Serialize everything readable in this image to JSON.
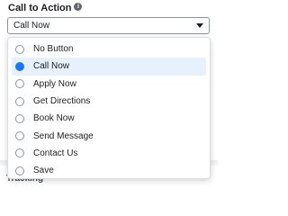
{
  "field": {
    "label": "Call to Action",
    "info_glyph": "i",
    "selected_value": "Call Now",
    "icons": {
      "info": "info-icon",
      "caret": "caret-down-icon"
    }
  },
  "colors": {
    "accent": "#1877f2",
    "selected_row": "#e7f0fd",
    "border": "#8d949e"
  },
  "options": [
    {
      "label": "No Button",
      "selected": false
    },
    {
      "label": "Call Now",
      "selected": true
    },
    {
      "label": "Apply Now",
      "selected": false
    },
    {
      "label": "Get Directions",
      "selected": false
    },
    {
      "label": "Book Now",
      "selected": false
    },
    {
      "label": "Send Message",
      "selected": false
    },
    {
      "label": "Contact Us",
      "selected": false
    },
    {
      "label": "Save",
      "selected": false
    }
  ],
  "background": {
    "section_heading": "Tracking"
  }
}
